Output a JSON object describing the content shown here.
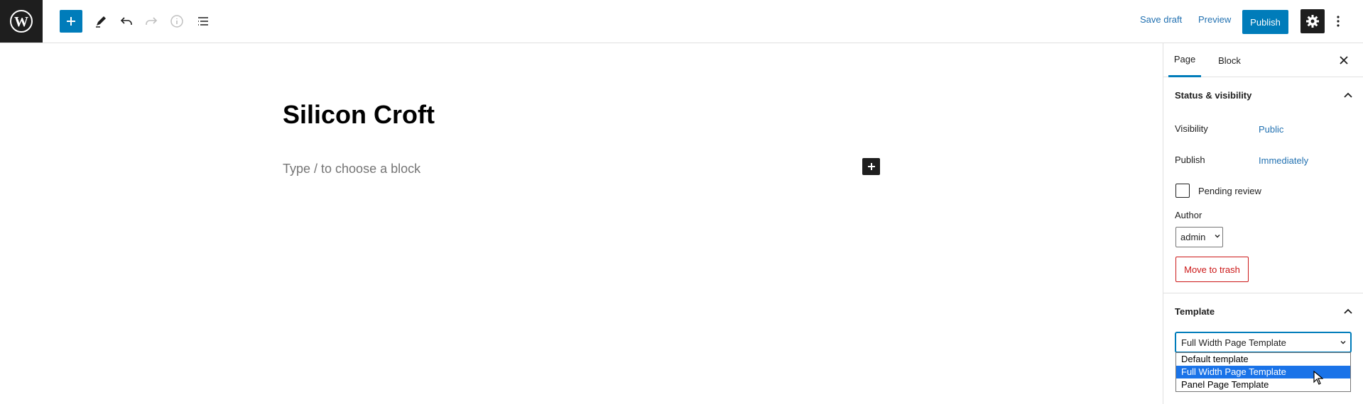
{
  "toolbar": {
    "logo_icon": "wordpress-icon",
    "add_block_icon": "plus-icon",
    "tools_icon": "pencil-icon",
    "undo_icon": "undo-icon",
    "redo_icon": "redo-icon",
    "details_icon": "info-icon",
    "outline_icon": "list-view-icon",
    "save_draft": "Save draft",
    "preview": "Preview",
    "publish": "Publish",
    "settings_icon": "gear-icon",
    "more_icon": "vertical-ellipsis-icon"
  },
  "editor": {
    "title": "Silicon Croft",
    "placeholder": "Type / to choose a block"
  },
  "sidebar": {
    "tabs": [
      {
        "label": "Page",
        "active": true
      },
      {
        "label": "Block",
        "active": false
      }
    ],
    "status_panel": {
      "title": "Status & visibility",
      "visibility_label": "Visibility",
      "visibility_value": "Public",
      "publish_label": "Publish",
      "publish_value": "Immediately",
      "pending_review_label": "Pending review",
      "pending_review_checked": false,
      "author_label": "Author",
      "author_value": "admin",
      "trash_label": "Move to trash"
    },
    "template_panel": {
      "title": "Template",
      "selected": "Full Width Page Template",
      "options": [
        "Default template",
        "Full Width Page Template",
        "Panel Page Template"
      ]
    }
  },
  "colors": {
    "accent": "#007cba",
    "danger": "#cc1818",
    "dark": "#1e1e1e",
    "link": "#2271b1"
  }
}
